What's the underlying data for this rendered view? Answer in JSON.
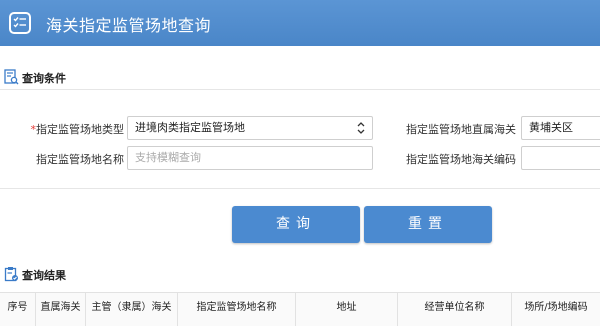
{
  "header": {
    "title": "海关指定监管场地查询",
    "icon": "checklist-icon"
  },
  "query_section": {
    "title": "查询条件",
    "icon": "search-document-icon"
  },
  "form": {
    "type_label": "指定监管场地类型",
    "type_required_mark": "*",
    "type_value": "进境肉类指定监管场地",
    "customs_label": "指定监管场地直属海关",
    "customs_value": "黄埔关区",
    "name_label": "指定监管场地名称",
    "name_placeholder": "支持模糊查询",
    "code_label": "指定监管场地海关编码",
    "code_value": ""
  },
  "buttons": {
    "query": "查询",
    "reset": "重置"
  },
  "result_section": {
    "title": "查询结果",
    "icon": "clipboard-check-icon"
  },
  "table": {
    "columns": [
      "序号",
      "直属海关",
      "主管（隶属）海关",
      "指定监管场地名称",
      "地址",
      "经营单位名称",
      "场所/场地编码"
    ]
  },
  "colors": {
    "primary": "#4b8ad0",
    "header": "#5b95d4",
    "required": "#e53935"
  }
}
